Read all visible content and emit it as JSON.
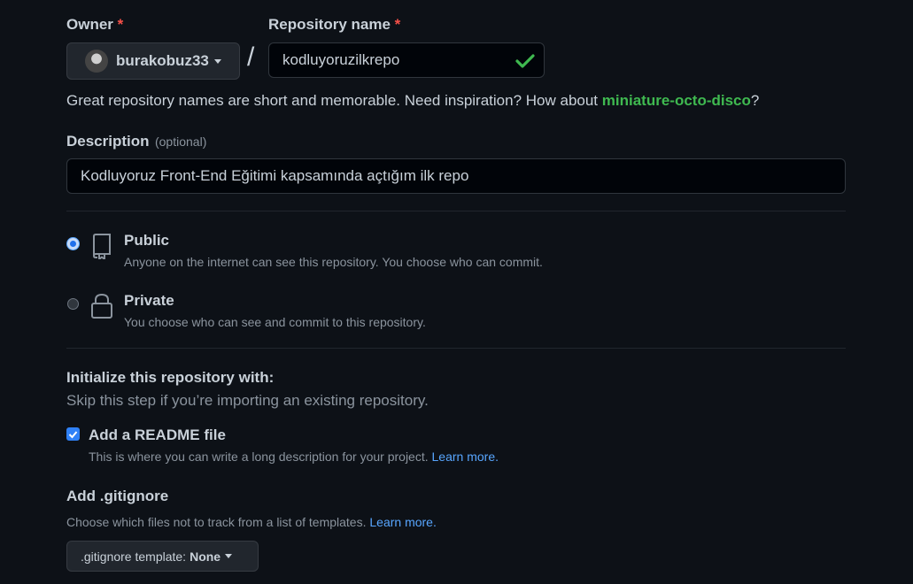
{
  "owner": {
    "label": "Owner",
    "required_mark": "*",
    "value": "burakobuz33"
  },
  "slash": "/",
  "repo_name": {
    "label": "Repository name",
    "required_mark": "*",
    "value": "kodluyoruzilkrepo",
    "status_icon": "check-icon"
  },
  "name_hint": {
    "prefix": "Great repository names are short and memorable. Need inspiration? How about ",
    "suggestion": "miniature-octo-disco",
    "suffix": "?"
  },
  "description": {
    "label": "Description",
    "optional": "(optional)",
    "value": "Kodluyoruz Front-End Eğitimi kapsamında açtığım ilk repo"
  },
  "visibility": {
    "public": {
      "title": "Public",
      "desc": "Anyone on the internet can see this repository. You choose who can commit.",
      "selected": true
    },
    "private": {
      "title": "Private",
      "desc": "You choose who can see and commit to this repository.",
      "selected": false
    }
  },
  "init": {
    "heading": "Initialize this repository with:",
    "subheading": "Skip this step if you’re importing an existing repository."
  },
  "readme": {
    "label": "Add a README file",
    "desc": "This is where you can write a long description for your project.",
    "link": "Learn more.",
    "checked": true
  },
  "gitignore": {
    "heading": "Add .gitignore",
    "desc": "Choose which files not to track from a list of templates.",
    "link": "Learn more.",
    "button_prefix": ".gitignore template:",
    "button_value": "None"
  },
  "colors": {
    "accent": "#58a6ff",
    "success": "#3fb950",
    "danger": "#f85149",
    "background": "#0d1117"
  }
}
